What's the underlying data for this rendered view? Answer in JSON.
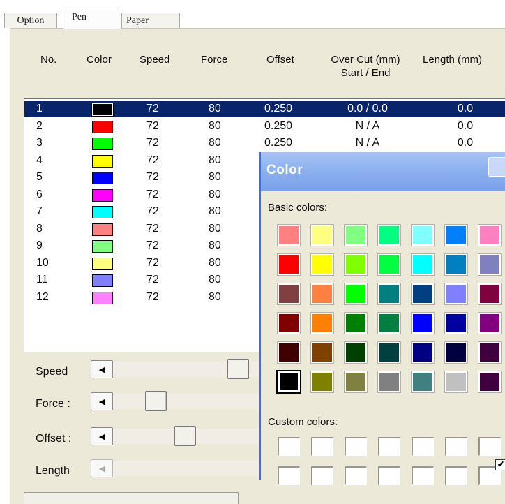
{
  "tabs": [
    {
      "label": "Option"
    },
    {
      "label": "Pen"
    },
    {
      "label": "Paper"
    }
  ],
  "headers": {
    "no": "No.",
    "color": "Color",
    "speed": "Speed",
    "force": "Force",
    "offset": "Offset",
    "overcut": "Over Cut (mm)",
    "overcut_sub": "Start / End",
    "length": "Length (mm)"
  },
  "pens": [
    {
      "no": "1",
      "color": "#000000",
      "speed": "72",
      "force": "80",
      "offset": "0.250",
      "overcut": "0.0 / 0.0",
      "length": "0.0"
    },
    {
      "no": "2",
      "color": "#ff0000",
      "speed": "72",
      "force": "80",
      "offset": "0.250",
      "overcut": "N / A",
      "length": "0.0"
    },
    {
      "no": "3",
      "color": "#00ff00",
      "speed": "72",
      "force": "80",
      "offset": "0.250",
      "overcut": "N / A",
      "length": "0.0"
    },
    {
      "no": "4",
      "color": "#ffff00",
      "speed": "72",
      "force": "80",
      "offset": "",
      "overcut": "",
      "length": ""
    },
    {
      "no": "5",
      "color": "#0000ff",
      "speed": "72",
      "force": "80",
      "offset": "",
      "overcut": "",
      "length": ""
    },
    {
      "no": "6",
      "color": "#ff00ff",
      "speed": "72",
      "force": "80",
      "offset": "",
      "overcut": "",
      "length": ""
    },
    {
      "no": "7",
      "color": "#00ffff",
      "speed": "72",
      "force": "80",
      "offset": "",
      "overcut": "",
      "length": ""
    },
    {
      "no": "8",
      "color": "#ff8080",
      "speed": "72",
      "force": "80",
      "offset": "",
      "overcut": "",
      "length": ""
    },
    {
      "no": "9",
      "color": "#80ff80",
      "speed": "72",
      "force": "80",
      "offset": "",
      "overcut": "",
      "length": ""
    },
    {
      "no": "10",
      "color": "#ffff80",
      "speed": "72",
      "force": "80",
      "offset": "",
      "overcut": "",
      "length": ""
    },
    {
      "no": "11",
      "color": "#8080ff",
      "speed": "72",
      "force": "80",
      "offset": "",
      "overcut": "",
      "length": ""
    },
    {
      "no": "12",
      "color": "#ff80ff",
      "speed": "72",
      "force": "80",
      "offset": "",
      "overcut": "",
      "length": ""
    }
  ],
  "sliders": {
    "speed": {
      "label": "Speed"
    },
    "force": {
      "label": "Force :"
    },
    "offset": {
      "label": "Offset :"
    },
    "length": {
      "label": "Length"
    }
  },
  "color_dialog": {
    "title": "Color",
    "basic_label": "Basic colors:",
    "custom_label": "Custom colors:",
    "basic_colors": [
      [
        "#ff8080",
        "#ffff80",
        "#80ff80",
        "#00ff80",
        "#80ffff",
        "#0080ff",
        "#ff80c0"
      ],
      [
        "#ff0000",
        "#ffff00",
        "#80ff00",
        "#00ff40",
        "#00ffff",
        "#0080c0",
        "#8080c0"
      ],
      [
        "#804040",
        "#ff8040",
        "#00ff00",
        "#008080",
        "#004080",
        "#8080ff",
        "#800040"
      ],
      [
        "#800000",
        "#ff8000",
        "#008000",
        "#008040",
        "#0000ff",
        "#0000a0",
        "#800080"
      ],
      [
        "#400000",
        "#804000",
        "#004000",
        "#004040",
        "#000080",
        "#000040",
        "#400040"
      ],
      [
        "#000000",
        "#808000",
        "#808040",
        "#808080",
        "#408080",
        "#c0c0c0",
        "#400040"
      ]
    ],
    "selected": "#000000"
  }
}
